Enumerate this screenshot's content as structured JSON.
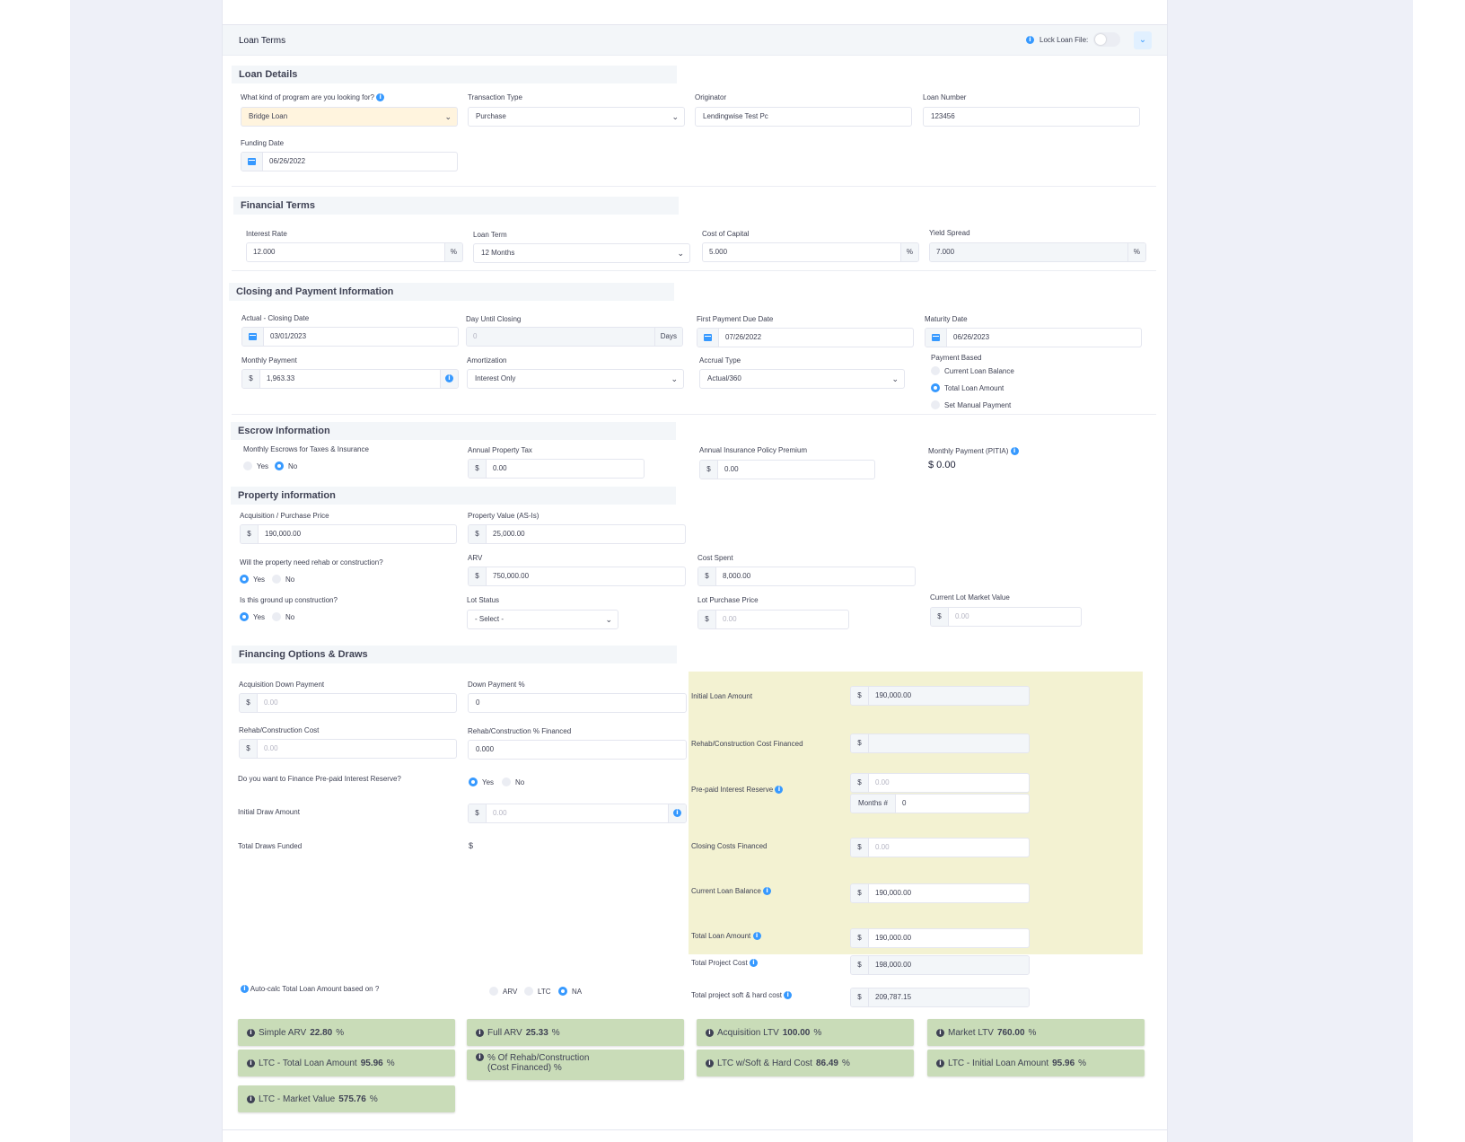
{
  "card": {
    "title": "Loan Terms",
    "lock_label": "Lock Loan File:"
  },
  "loan_details": {
    "heading": "Loan Details",
    "program_label": "What kind of program are you looking for?",
    "program_value": "Bridge Loan",
    "transaction_label": "Transaction Type",
    "transaction_value": "Purchase",
    "originator_label": "Originator",
    "originator_value": "Lendingwise Test Pc",
    "loan_number_label": "Loan Number",
    "loan_number_value": "123456",
    "funding_label": "Funding Date",
    "funding_value": "06/26/2022"
  },
  "financial_terms": {
    "heading": "Financial Terms",
    "interest_label": "Interest Rate",
    "interest_value": "12.000",
    "term_label": "Loan Term",
    "term_value": "12 Months",
    "cost_label": "Cost of Capital",
    "cost_value": "5.000",
    "yield_label": "Yield Spread",
    "yield_value": "7.000",
    "pct": "%"
  },
  "closing": {
    "heading": "Closing and Payment Information",
    "actual_label": "Actual - Closing Date",
    "actual_value": "03/01/2023",
    "days_label": "Day Until Closing",
    "days_value": "0",
    "days_suffix": "Days",
    "first_due_label": "First Payment Due Date",
    "first_due_value": "07/26/2022",
    "maturity_label": "Maturity Date",
    "maturity_value": "06/26/2023",
    "monthly_label": "Monthly Payment",
    "monthly_value": "1,963.33",
    "amort_label": "Amortization",
    "amort_value": "Interest Only",
    "accrual_label": "Accrual Type",
    "accrual_value": "Actual/360",
    "payment_based_label": "Payment Based",
    "payment_based_options": [
      "Current Loan Balance",
      "Total Loan Amount",
      "Set Manual Payment"
    ]
  },
  "escrow": {
    "heading": "Escrow Information",
    "monthly_escrows_label": "Monthly Escrows for Taxes & Insurance",
    "yes": "Yes",
    "no": "No",
    "tax_label": "Annual Property Tax",
    "tax_value": "0.00",
    "insurance_label": "Annual Insurance Policy Premium",
    "insurance_value": "0.00",
    "pitia_label": "Monthly Payment (PITIA)",
    "pitia_value": "$ 0.00"
  },
  "property": {
    "heading": "Property information",
    "purchase_label": "Acquisition / Purchase Price",
    "purchase_value": "190,000.00",
    "asis_label": "Property Value (AS-Is)",
    "asis_value": "25,000.00",
    "rehab_q": "Will the property need rehab or construction?",
    "arv_label": "ARV",
    "arv_value": "750,000.00",
    "cost_spent_label": "Cost Spent",
    "cost_spent_value": "8,000.00",
    "ground_q": "Is this ground up construction?",
    "lot_status_label": "Lot Status",
    "lot_status_value": "- Select -",
    "lot_purchase_label": "Lot Purchase Price",
    "lot_purchase_value": "0.00",
    "lot_market_label": "Current Lot Market Value",
    "lot_market_value": "0.00",
    "yes": "Yes",
    "no": "No"
  },
  "financing": {
    "heading": "Financing Options & Draws",
    "acq_down_label": "Acquisition Down Payment",
    "acq_down_value": "0.00",
    "down_pct_label": "Down Payment %",
    "down_pct_value": "0",
    "rehab_cost_label": "Rehab/Construction Cost",
    "rehab_cost_value": "0.00",
    "rehab_pct_label": "Rehab/Construction % Financed",
    "rehab_pct_value": "0.000",
    "prepaid_q": "Do you want to Finance Pre-paid Interest Reserve?",
    "yes": "Yes",
    "no": "No",
    "initial_draw_label": "Initial Draw Amount",
    "initial_draw_value": "0.00",
    "total_draws_label": "Total Draws Funded",
    "total_draws_value": "$",
    "initial_loan_label": "Initial Loan Amount",
    "initial_loan_value": "190,000.00",
    "rehab_financed_label": "Rehab/Construction Cost Financed",
    "rehab_financed_value": "",
    "prepaid_label": "Pre-paid Interest Reserve",
    "prepaid_value": "0.00",
    "months_prefix": "Months #",
    "months_value": "0",
    "closing_costs_label": "Closing Costs Financed",
    "closing_costs_value": "0.00",
    "current_balance_label": "Current Loan Balance",
    "current_balance_value": "190,000.00",
    "total_loan_label": "Total Loan Amount",
    "total_loan_value": "190,000.00",
    "total_project_label": "Total Project Cost",
    "total_project_value": "198,000.00",
    "soft_hard_label": "Total project soft & hard cost",
    "soft_hard_value": "209,787.15",
    "autocalc_label": "Auto-calc Total Loan Amount based on ?",
    "autocalc_options": [
      "ARV",
      "LTC",
      "NA"
    ],
    "dollar": "$"
  },
  "metrics": [
    {
      "label": "Simple ARV",
      "value": "22.80",
      "unit": "%"
    },
    {
      "label": "Full ARV",
      "value": "25.33",
      "unit": "%"
    },
    {
      "label": "Acquisition LTV",
      "value": "100.00",
      "unit": "%"
    },
    {
      "label": "Market LTV",
      "value": "760.00",
      "unit": "%"
    },
    {
      "label": "LTC - Total Loan Amount",
      "value": "95.96",
      "unit": "%"
    },
    {
      "label": "% Of Rehab/Construction",
      "label2": "(Cost Financed) %",
      "value": "",
      "unit": ""
    },
    {
      "label": "LTC w/Soft & Hard Cost",
      "value": "86.49",
      "unit": "%"
    },
    {
      "label": "LTC - Initial Loan Amount",
      "value": "95.96",
      "unit": "%"
    },
    {
      "label": "LTC - Market Value",
      "value": "575.76",
      "unit": "%"
    }
  ],
  "colors": {
    "accent": "#3699ff",
    "yellow_panel": "#f3f2d2",
    "metric_green": "#c9dcb8",
    "warn_select": "#fff4de"
  }
}
